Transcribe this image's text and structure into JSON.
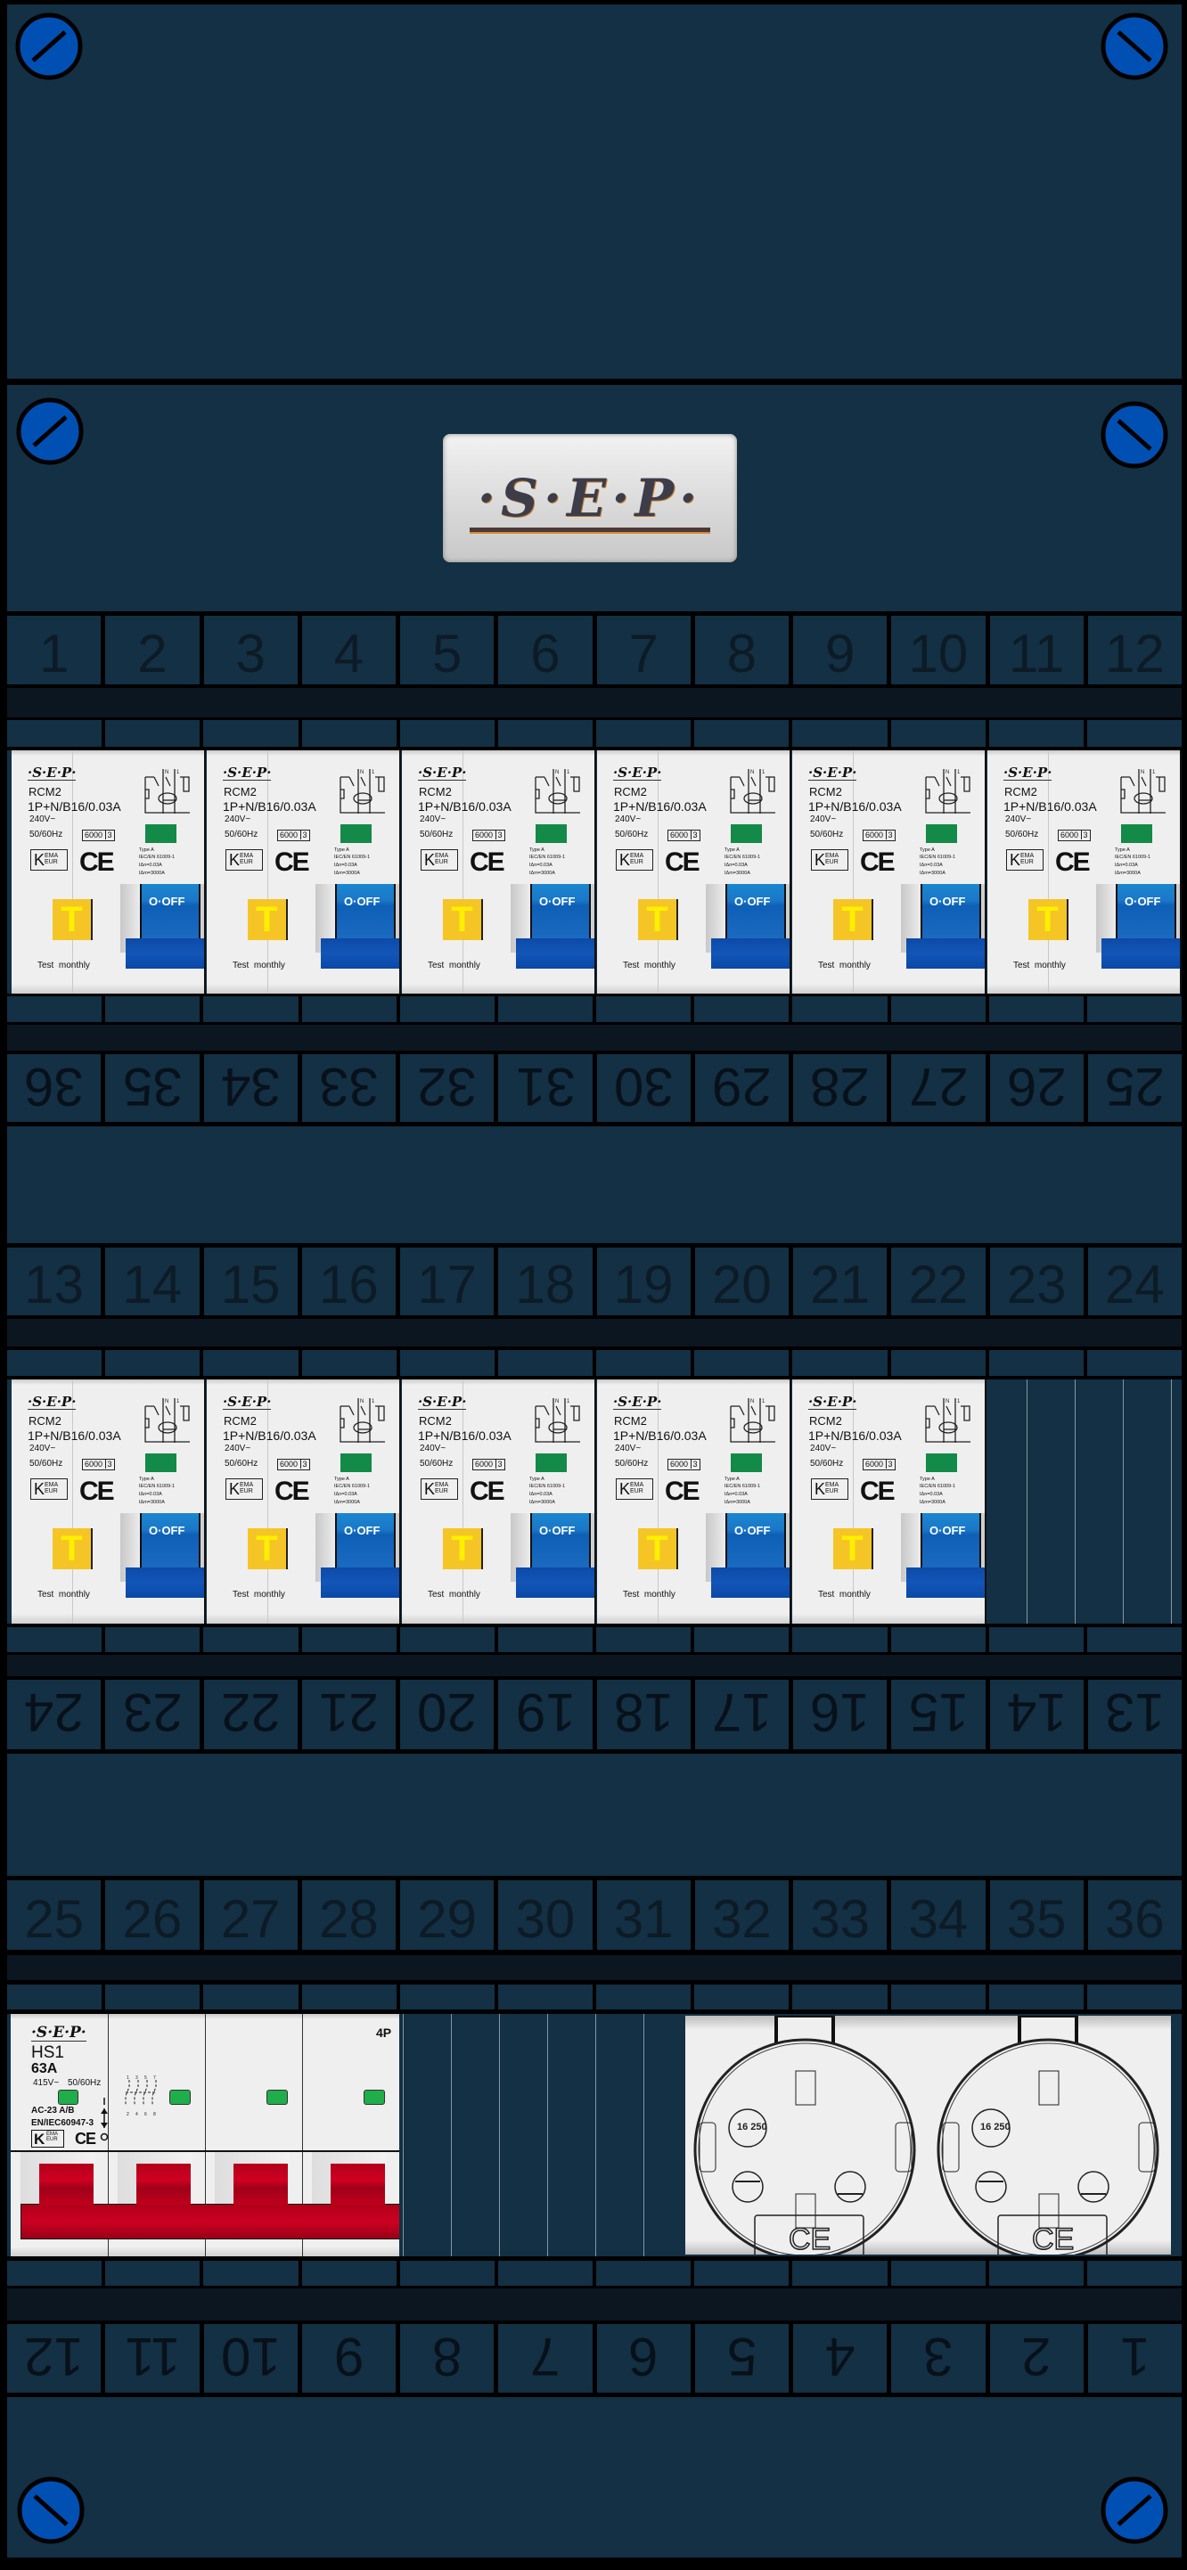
{
  "brand": "·S·E·P·",
  "logo_text": "·S·E·P·",
  "row1": {
    "labels": [
      "1",
      "2",
      "3",
      "4",
      "5",
      "6",
      "7",
      "8",
      "9",
      "10",
      "11",
      "12"
    ],
    "reversed_labels": [
      "36",
      "35",
      "34",
      "33",
      "32",
      "31",
      "30",
      "29",
      "28",
      "27",
      "26",
      "25"
    ]
  },
  "row2": {
    "labels": [
      "13",
      "14",
      "15",
      "16",
      "17",
      "18",
      "19",
      "20",
      "21",
      "22",
      "23",
      "24"
    ],
    "reversed_labels": [
      "24",
      "23",
      "22",
      "21",
      "20",
      "19",
      "18",
      "17",
      "16",
      "15",
      "14",
      "13"
    ]
  },
  "row3": {
    "labels": [
      "25",
      "26",
      "27",
      "28",
      "29",
      "30",
      "31",
      "32",
      "33",
      "34",
      "35",
      "36"
    ],
    "reversed_labels": [
      "12",
      "11",
      "10",
      "9",
      "8",
      "7",
      "6",
      "5",
      "4",
      "3",
      "2",
      "1"
    ]
  },
  "rcm_breaker": {
    "brand": "·S·E·P·",
    "model": "RCM2",
    "rating": "1P+N/B16/0.03A",
    "voltage": "240V~",
    "frequency": "50/60Hz",
    "capacity": "6000",
    "capacity_class": "3",
    "cert_k": "K",
    "cert_text": "EMA EUR",
    "ce": "CE",
    "type": "Type A",
    "standard": "IEC/EN 61009-1",
    "idn": "IΔn=0.03A",
    "idm": "IΔm=3000A",
    "switch_label": "O·OFF",
    "test_button": "T",
    "test_note": "Test  monthly",
    "indicator_color": "#138a48",
    "switch_color": "#1a78c8"
  },
  "main_switch": {
    "brand": "·S·E·P·",
    "model": "HS1",
    "current": "63A",
    "voltage": "415V~",
    "frequency": "50/60Hz",
    "category": "AC-23 A/B",
    "standard": "EN/IEC60947-3",
    "cert_k": "K",
    "cert_text": "EMA EUR",
    "ce": "CE",
    "poles": "4P",
    "terminals_top": [
      "1",
      "3",
      "5",
      "7"
    ],
    "terminals_bottom": [
      "2",
      "4",
      "6",
      "8"
    ],
    "handle_color": "#c0001c",
    "indicator_color": "#1fae4a"
  },
  "sockets": [
    {
      "rating": "16 250",
      "ce": "CE"
    },
    {
      "rating": "16 250",
      "ce": "CE"
    }
  ],
  "colors": {
    "panel": "#133044",
    "screw": "#0050b4",
    "strip": "#0c1620"
  }
}
